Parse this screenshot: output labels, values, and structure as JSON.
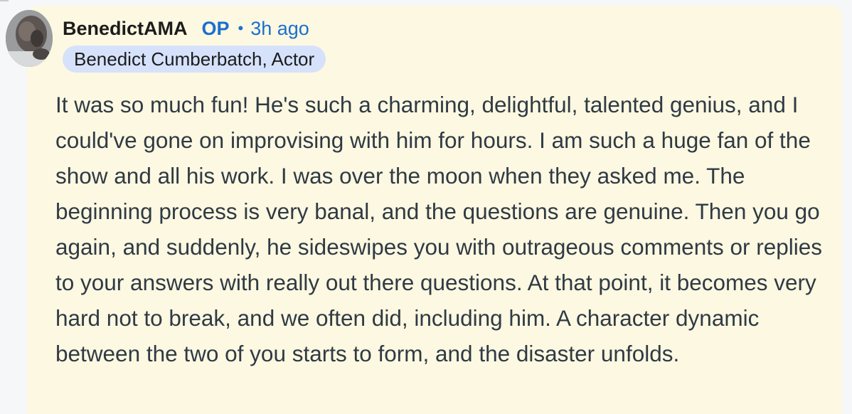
{
  "comment": {
    "author": "BenedictAMA",
    "op_badge": "OP",
    "separator": "•",
    "timestamp": "3h ago",
    "flair": "Benedict Cumberbatch, Actor",
    "body": "It was so much fun! He's such a charming, delightful, talented genius, and I could've gone on improvising with him for hours. I am such a huge fan of the show and all his work. I was over the moon when they asked me. The beginning process is very banal, and the questions are genuine. Then you go again, and suddenly, he sideswipes you with outrageous comments or replies to your answers with really out there questions. At that point, it becomes very hard not to break, and we often did, including him. A character dynamic between the two of you starts to form, and the disaster unfolds."
  },
  "colors": {
    "card_background": "#fdf8e1",
    "accent_blue": "#1a6fd0",
    "flair_background": "#d6e2fb",
    "body_text": "#2f3a44"
  },
  "icons": {
    "avatar": "user-avatar-image"
  }
}
